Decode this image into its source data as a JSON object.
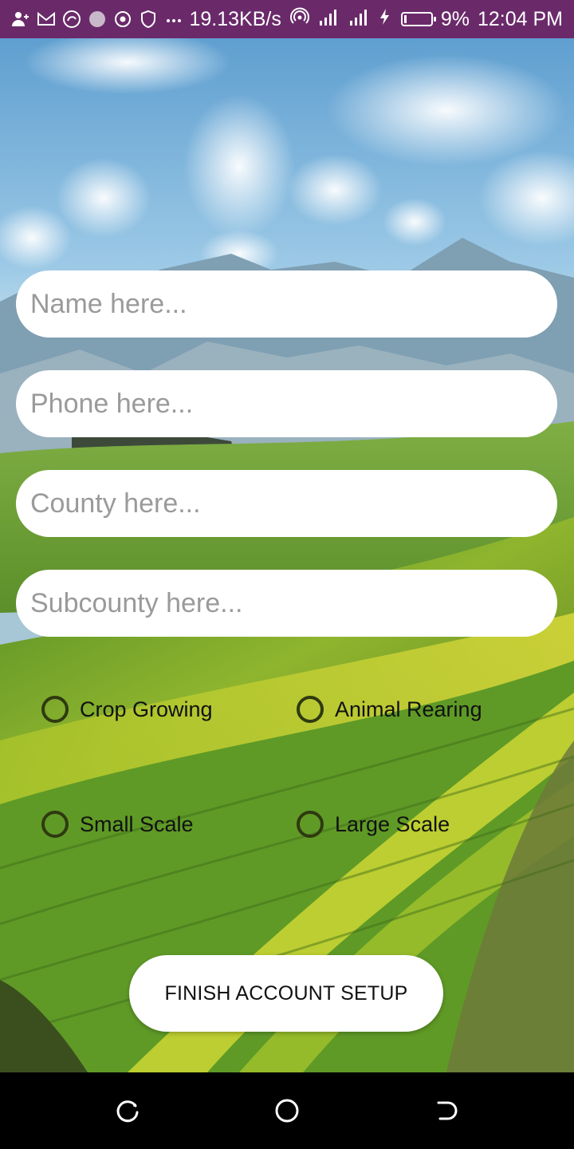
{
  "status_bar": {
    "network_speed": "19.13KB/s",
    "battery_level": "9%",
    "battery_fraction": 0.09,
    "time": "12:04 PM",
    "left_icons": [
      "add-user-icon",
      "gmail-icon",
      "app-icon",
      "app-icon-2",
      "record-icon",
      "shield-icon",
      "more-dots-icon"
    ],
    "right_icons": [
      "hotspot-icon",
      "signal-icon",
      "signal-roaming-icon",
      "charging-icon",
      "battery-icon"
    ],
    "color": "#6a2a6a"
  },
  "form": {
    "name_placeholder": "Name here...",
    "phone_placeholder": "Phone here...",
    "county_placeholder": "County here...",
    "subcounty_placeholder": "Subcounty here...",
    "options": {
      "crop_growing": "Crop Growing",
      "animal_rearing": "Animal Rearing",
      "small_scale": "Small Scale",
      "large_scale": "Large Scale"
    },
    "submit_label": "FINISH ACCOUNT SETUP"
  },
  "nav_bar": {
    "buttons": [
      "recent-apps-icon",
      "home-icon",
      "back-icon"
    ]
  }
}
